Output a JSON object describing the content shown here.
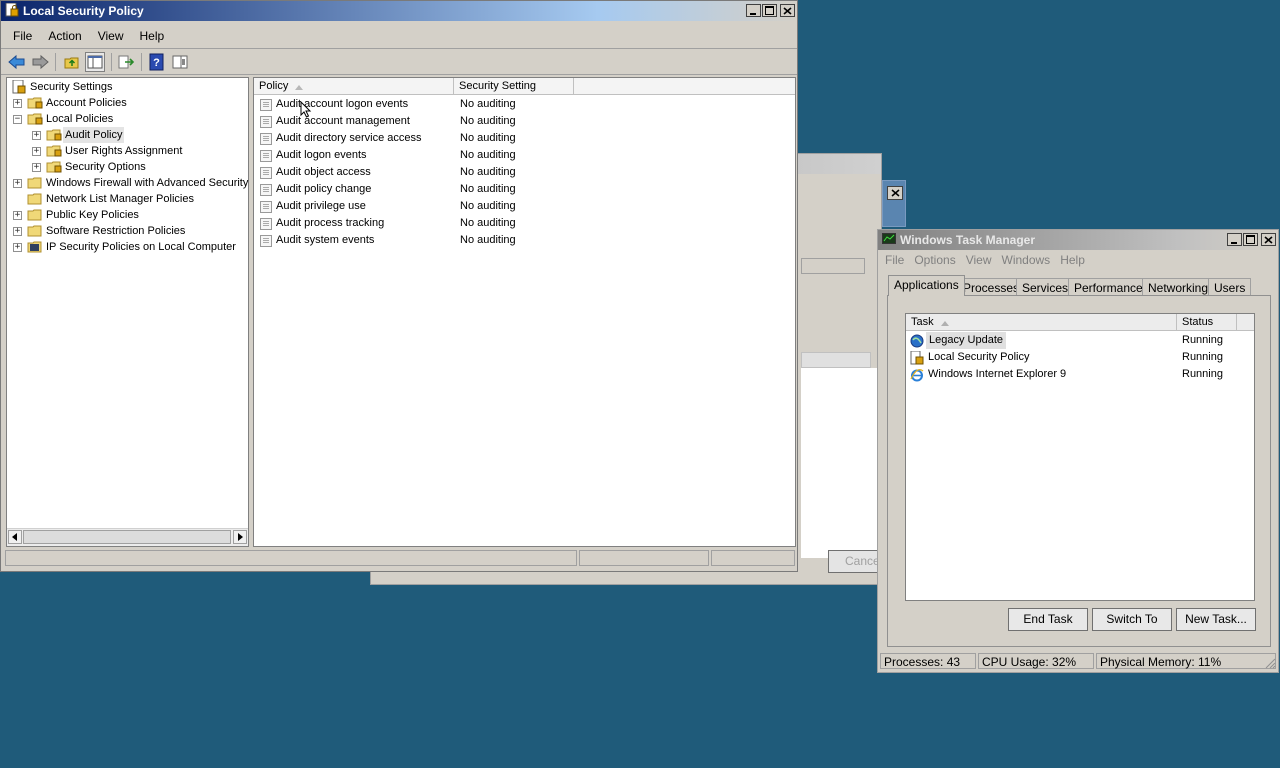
{
  "lsp": {
    "title": "Local Security Policy",
    "menu": [
      "File",
      "Action",
      "View",
      "Help"
    ],
    "tree": {
      "root": "Security Settings",
      "items": [
        {
          "label": "Account Policies",
          "level": 1,
          "expander": "+"
        },
        {
          "label": "Local Policies",
          "level": 1,
          "expander": "−"
        },
        {
          "label": "Audit Policy",
          "level": 2,
          "expander": "+",
          "selected": true
        },
        {
          "label": "User Rights Assignment",
          "level": 2,
          "expander": "+"
        },
        {
          "label": "Security Options",
          "level": 2,
          "expander": "+"
        },
        {
          "label": "Windows Firewall with Advanced Security",
          "level": 1,
          "expander": "+"
        },
        {
          "label": "Network List Manager Policies",
          "level": 1,
          "expander": ""
        },
        {
          "label": "Public Key Policies",
          "level": 1,
          "expander": "+"
        },
        {
          "label": "Software Restriction Policies",
          "level": 1,
          "expander": "+"
        },
        {
          "label": "IP Security Policies on Local Computer",
          "level": 1,
          "expander": "+"
        }
      ]
    },
    "list": {
      "columns": [
        "Policy",
        "Security Setting"
      ],
      "rows": [
        {
          "policy": "Audit account logon events",
          "setting": "No auditing"
        },
        {
          "policy": "Audit account management",
          "setting": "No auditing"
        },
        {
          "policy": "Audit directory service access",
          "setting": "No auditing"
        },
        {
          "policy": "Audit logon events",
          "setting": "No auditing"
        },
        {
          "policy": "Audit object access",
          "setting": "No auditing"
        },
        {
          "policy": "Audit policy change",
          "setting": "No auditing"
        },
        {
          "policy": "Audit privilege use",
          "setting": "No auditing"
        },
        {
          "policy": "Audit process tracking",
          "setting": "No auditing"
        },
        {
          "policy": "Audit system events",
          "setting": "No auditing"
        }
      ]
    }
  },
  "background_dialog": {
    "cancel_label": "Cance"
  },
  "taskmgr": {
    "title": "Windows Task Manager",
    "menu": [
      "File",
      "Options",
      "View",
      "Windows",
      "Help"
    ],
    "tabs": [
      "Applications",
      "Processes",
      "Services",
      "Performance",
      "Networking",
      "Users"
    ],
    "active_tab": "Applications",
    "columns": [
      "Task",
      "Status"
    ],
    "tasks": [
      {
        "task": "Legacy Update",
        "status": "Running",
        "icon": "globe-icon"
      },
      {
        "task": "Local Security Policy",
        "status": "Running",
        "icon": "security-policy-icon"
      },
      {
        "task": "Windows Internet Explorer 9",
        "status": "Running",
        "icon": "ie-icon"
      }
    ],
    "buttons": {
      "end_task": "End Task",
      "switch_to": "Switch To",
      "new_task": "New Task..."
    },
    "status": {
      "processes": "Processes: 43",
      "cpu": "CPU Usage: 32%",
      "memory": "Physical Memory: 11%"
    }
  },
  "colors": {
    "desktop": "#1f5b7a",
    "active_title_start": "#0a246a",
    "active_title_end": "#a6caf0",
    "inactive_title_start": "#808080",
    "inactive_title_end": "#c0c0c0"
  }
}
